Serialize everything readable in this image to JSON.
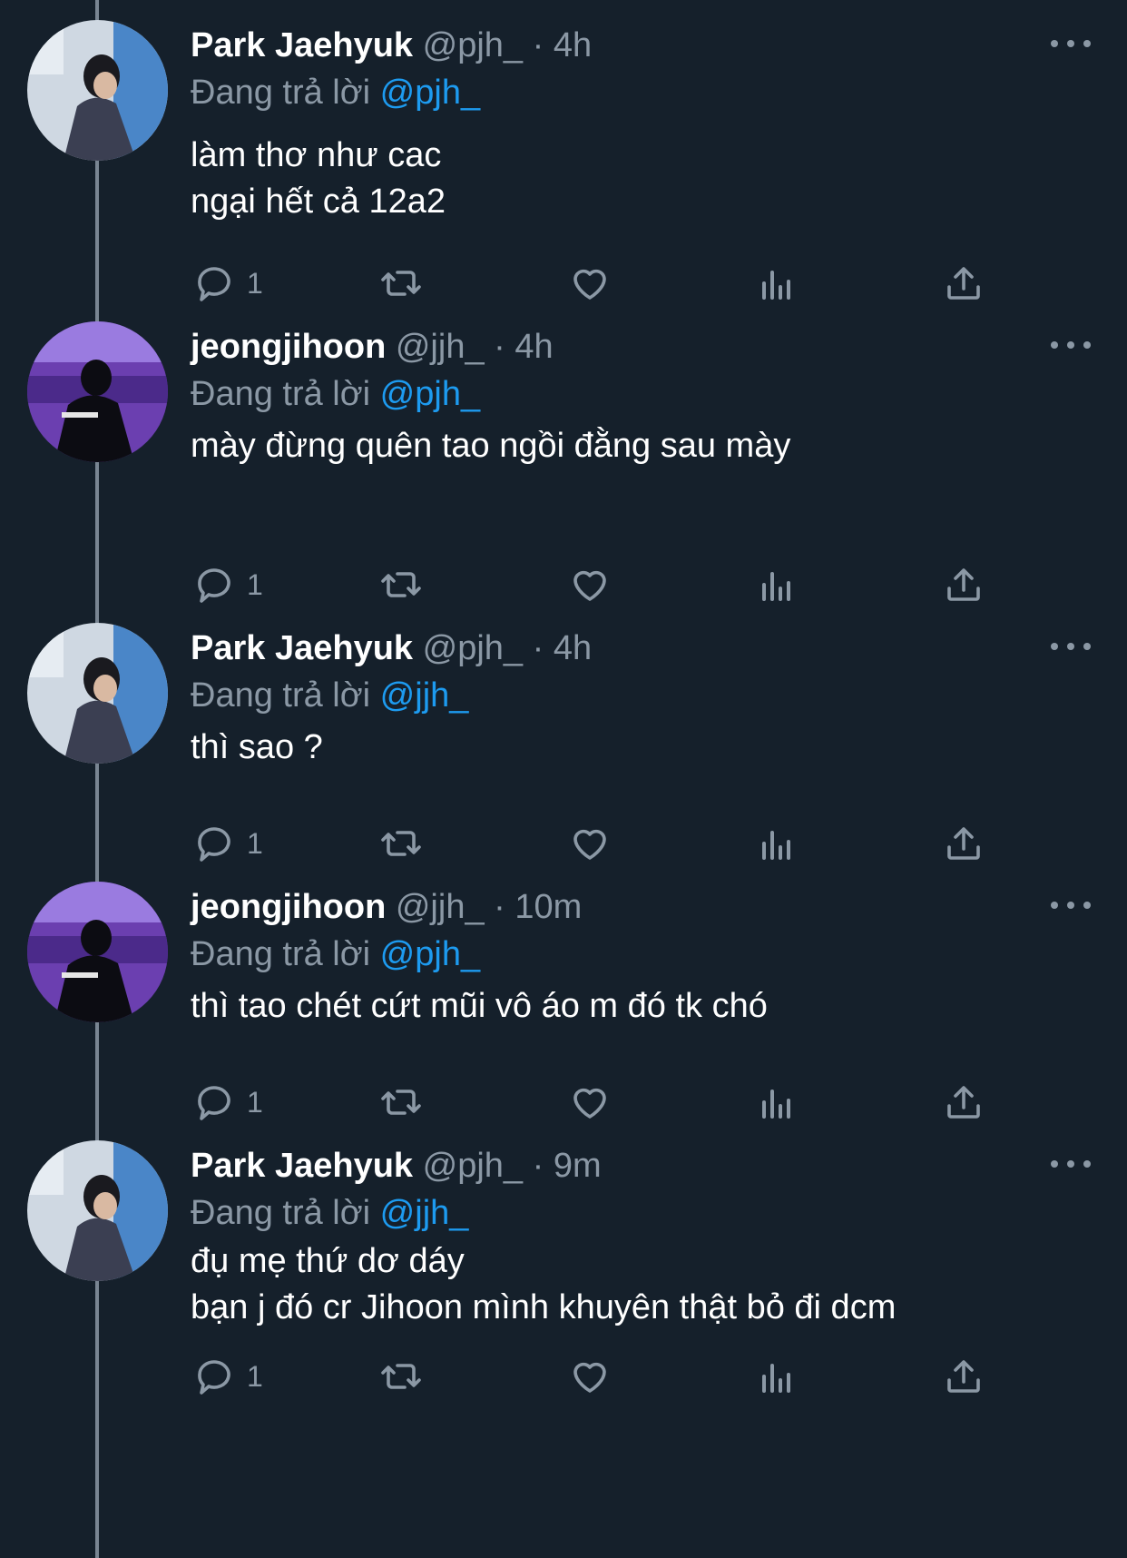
{
  "thread": {
    "reply_prefix": "Đang trả lời",
    "colors": {
      "background": "#15202b",
      "text_primary": "#ffffff",
      "text_secondary": "#8b98a5",
      "accent": "#1d9bf0"
    },
    "action_icons": [
      "reply-icon",
      "retweet-icon",
      "like-icon",
      "analytics-icon",
      "share-icon"
    ],
    "tweets": [
      {
        "display_name": "Park Jaehyuk",
        "handle": "@pjh_",
        "separator": "·",
        "time": "4h",
        "reply_to": "@pjh_",
        "lines": [
          "làm thơ như cac",
          "ngại hết cả 12a2"
        ],
        "reply_count": "1"
      },
      {
        "display_name": "jeongjihoon",
        "handle": "@jjh_",
        "separator": "·",
        "time": "4h",
        "reply_to": "@pjh_",
        "lines": [
          "mày đừng quên tao ngồi đằng sau mày"
        ],
        "reply_count": "1"
      },
      {
        "display_name": "Park Jaehyuk",
        "handle": "@pjh_",
        "separator": "·",
        "time": "4h",
        "reply_to": "@jjh_",
        "lines": [
          "thì sao ?"
        ],
        "reply_count": "1"
      },
      {
        "display_name": "jeongjihoon",
        "handle": "@jjh_",
        "separator": "·",
        "time": "10m",
        "reply_to": "@pjh_",
        "lines": [
          "thì tao chét cứt mũi vô áo m đó tk chó"
        ],
        "reply_count": "1"
      },
      {
        "display_name": "Park Jaehyuk",
        "handle": "@pjh_",
        "separator": "·",
        "time": "9m",
        "reply_to": "@jjh_",
        "lines": [
          "đụ mẹ thứ dơ dáy",
          "bạn j đó cr Jihoon mình khuyên thật bỏ đi dcm"
        ],
        "reply_count": "1"
      }
    ]
  }
}
